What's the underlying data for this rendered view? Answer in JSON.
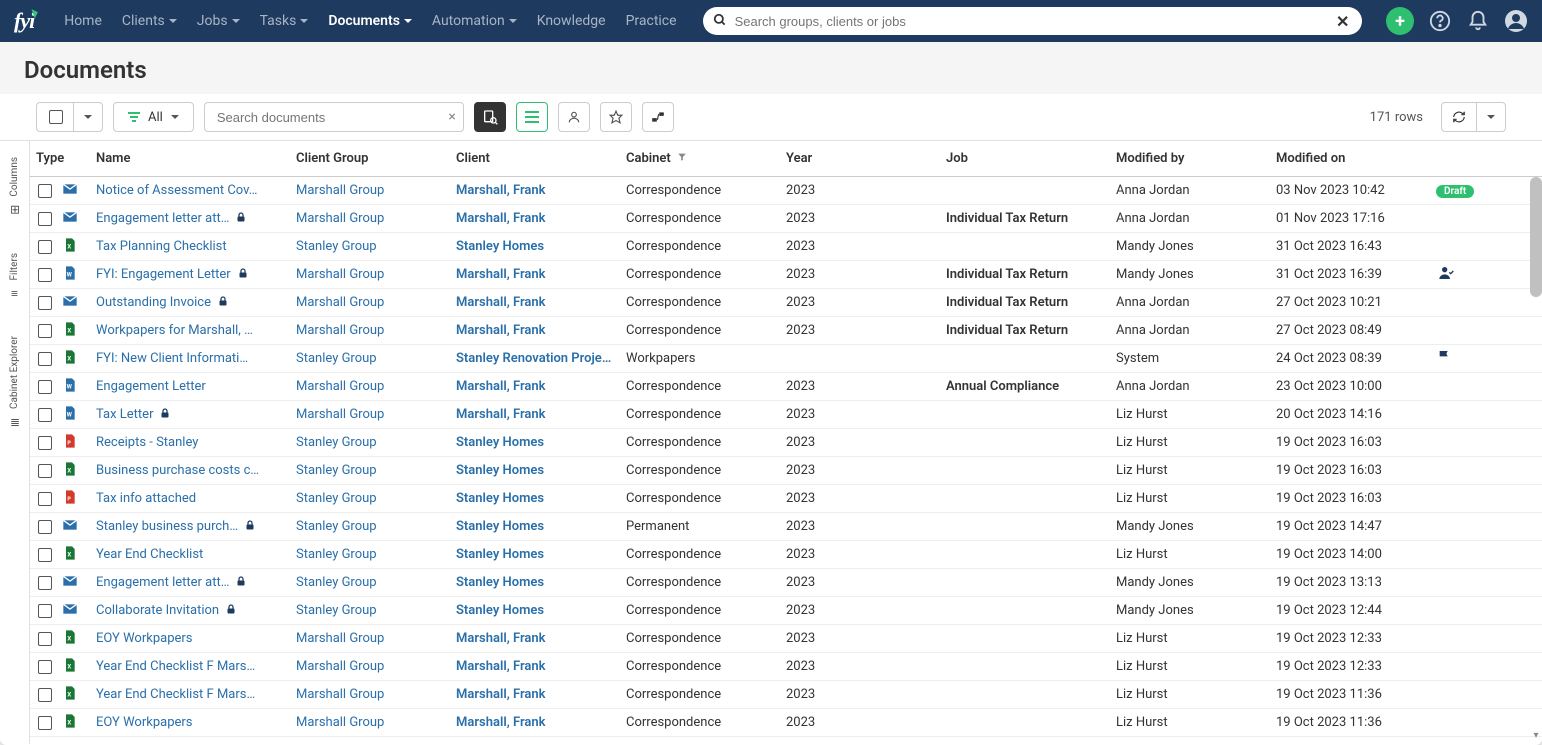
{
  "nav": {
    "items": [
      "Home",
      "Clients",
      "Jobs",
      "Tasks",
      "Documents",
      "Automation",
      "Knowledge",
      "Practice"
    ],
    "active": "Documents",
    "search_placeholder": "Search groups, clients or jobs"
  },
  "page": {
    "title": "Documents"
  },
  "toolbar": {
    "filter_label": "All",
    "search_placeholder": "Search documents",
    "row_count": "171 rows"
  },
  "rails": {
    "columns": "Columns",
    "filters": "Filters",
    "cabinet": "Cabinet Explorer"
  },
  "table": {
    "headers": [
      "Type",
      "Name",
      "Client Group",
      "Client",
      "Cabinet",
      "Year",
      "Job",
      "Modified by",
      "Modified on",
      ""
    ],
    "rows": [
      {
        "icon": "mail",
        "name": "Notice of Assessment Cov…",
        "lock": false,
        "group": "Marshall Group",
        "client": "Marshall, Frank",
        "cabinet": "Correspondence",
        "year": "2023",
        "job": "",
        "by": "Anna Jordan",
        "on": "03 Nov 2023 10:42",
        "status": "draft"
      },
      {
        "icon": "mail",
        "name": "Engagement letter att…",
        "lock": true,
        "group": "Marshall Group",
        "client": "Marshall, Frank",
        "cabinet": "Correspondence",
        "year": "2023",
        "job": "Individual Tax Return",
        "by": "Anna Jordan",
        "on": "01 Nov 2023 17:16",
        "status": ""
      },
      {
        "icon": "xls",
        "name": "Tax Planning Checklist",
        "lock": false,
        "group": "Stanley Group",
        "client": "Stanley Homes",
        "cabinet": "Correspondence",
        "year": "2023",
        "job": "",
        "by": "Mandy Jones",
        "on": "31 Oct 2023 16:43",
        "status": ""
      },
      {
        "icon": "word",
        "name": "FYI: Engagement Letter",
        "lock": true,
        "group": "Marshall Group",
        "client": "Marshall, Frank",
        "cabinet": "Correspondence",
        "year": "2023",
        "job": "Individual Tax Return",
        "by": "Mandy Jones",
        "on": "31 Oct 2023 16:39",
        "status": "person"
      },
      {
        "icon": "mail",
        "name": "Outstanding Invoice",
        "lock": true,
        "group": "Marshall Group",
        "client": "Marshall, Frank",
        "cabinet": "Correspondence",
        "year": "2023",
        "job": "Individual Tax Return",
        "by": "Anna Jordan",
        "on": "27 Oct 2023 10:21",
        "status": ""
      },
      {
        "icon": "xls",
        "name": "Workpapers for Marshall, …",
        "lock": false,
        "group": "Marshall Group",
        "client": "Marshall, Frank",
        "cabinet": "Correspondence",
        "year": "2023",
        "job": "Individual Tax Return",
        "by": "Anna Jordan",
        "on": "27 Oct 2023 08:49",
        "status": ""
      },
      {
        "icon": "xls",
        "name": "FYI: New Client Informati…",
        "lock": false,
        "group": "Stanley Group",
        "client": "Stanley Renovation Projects",
        "cabinet": "Workpapers",
        "year": "",
        "job": "",
        "by": "System",
        "on": "24 Oct 2023 08:39",
        "status": "flag"
      },
      {
        "icon": "word",
        "name": "Engagement Letter",
        "lock": false,
        "group": "Marshall Group",
        "client": "Marshall, Frank",
        "cabinet": "Correspondence",
        "year": "2023",
        "job": "Annual Compliance",
        "by": "Anna Jordan",
        "on": "23 Oct 2023 10:00",
        "status": ""
      },
      {
        "icon": "word",
        "name": "Tax Letter",
        "lock": true,
        "group": "Marshall Group",
        "client": "Marshall, Frank",
        "cabinet": "Correspondence",
        "year": "2023",
        "job": "",
        "by": "Liz Hurst",
        "on": "20 Oct 2023 14:16",
        "status": ""
      },
      {
        "icon": "pdf",
        "name": "Receipts - Stanley",
        "lock": false,
        "group": "Stanley Group",
        "client": "Stanley Homes",
        "cabinet": "Correspondence",
        "year": "2023",
        "job": "",
        "by": "Liz Hurst",
        "on": "19 Oct 2023 16:03",
        "status": ""
      },
      {
        "icon": "xls",
        "name": "Business purchase costs c…",
        "lock": false,
        "group": "Stanley Group",
        "client": "Stanley Homes",
        "cabinet": "Correspondence",
        "year": "2023",
        "job": "",
        "by": "Liz Hurst",
        "on": "19 Oct 2023 16:03",
        "status": ""
      },
      {
        "icon": "pdf",
        "name": "Tax info attached",
        "lock": false,
        "group": "Stanley Group",
        "client": "Stanley Homes",
        "cabinet": "Correspondence",
        "year": "2023",
        "job": "",
        "by": "Liz Hurst",
        "on": "19 Oct 2023 16:03",
        "status": ""
      },
      {
        "icon": "mail",
        "name": "Stanley business purch…",
        "lock": true,
        "group": "Stanley Group",
        "client": "Stanley Homes",
        "cabinet": "Permanent",
        "year": "2023",
        "job": "",
        "by": "Mandy Jones",
        "on": "19 Oct 2023 14:47",
        "status": ""
      },
      {
        "icon": "xls",
        "name": "Year End Checklist",
        "lock": false,
        "group": "Stanley Group",
        "client": "Stanley Homes",
        "cabinet": "Correspondence",
        "year": "2023",
        "job": "",
        "by": "Liz Hurst",
        "on": "19 Oct 2023 14:00",
        "status": ""
      },
      {
        "icon": "mail",
        "name": "Engagement letter att…",
        "lock": true,
        "group": "Stanley Group",
        "client": "Stanley Homes",
        "cabinet": "Correspondence",
        "year": "2023",
        "job": "",
        "by": "Mandy Jones",
        "on": "19 Oct 2023 13:13",
        "status": ""
      },
      {
        "icon": "mail",
        "name": "Collaborate Invitation",
        "lock": true,
        "group": "Stanley Group",
        "client": "Stanley Homes",
        "cabinet": "Correspondence",
        "year": "2023",
        "job": "",
        "by": "Mandy Jones",
        "on": "19 Oct 2023 12:44",
        "status": ""
      },
      {
        "icon": "xls",
        "name": "EOY Workpapers",
        "lock": false,
        "group": "Marshall Group",
        "client": "Marshall, Frank",
        "cabinet": "Correspondence",
        "year": "2023",
        "job": "",
        "by": "Liz Hurst",
        "on": "19 Oct 2023 12:33",
        "status": ""
      },
      {
        "icon": "xls",
        "name": "Year End Checklist F Mars…",
        "lock": false,
        "group": "Marshall Group",
        "client": "Marshall, Frank",
        "cabinet": "Correspondence",
        "year": "2023",
        "job": "",
        "by": "Liz Hurst",
        "on": "19 Oct 2023 12:33",
        "status": ""
      },
      {
        "icon": "xls",
        "name": "Year End Checklist F Mars…",
        "lock": false,
        "group": "Marshall Group",
        "client": "Marshall, Frank",
        "cabinet": "Correspondence",
        "year": "2023",
        "job": "",
        "by": "Liz Hurst",
        "on": "19 Oct 2023 11:36",
        "status": ""
      },
      {
        "icon": "xls",
        "name": "EOY Workpapers",
        "lock": false,
        "group": "Marshall Group",
        "client": "Marshall, Frank",
        "cabinet": "Correspondence",
        "year": "2023",
        "job": "",
        "by": "Liz Hurst",
        "on": "19 Oct 2023 11:36",
        "status": ""
      }
    ]
  },
  "icons": {
    "mail_color": "#2a6faa",
    "xls_color": "#1a7733",
    "pdf_color": "#d33a2c",
    "word_color": "#2a6faa"
  }
}
